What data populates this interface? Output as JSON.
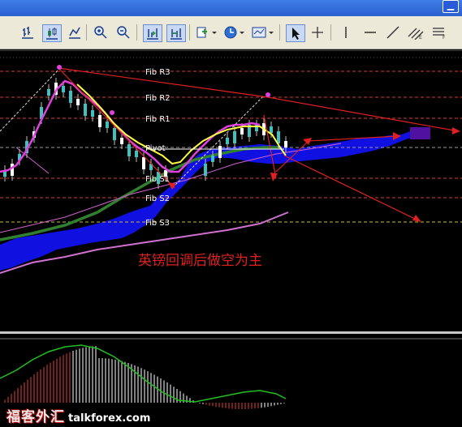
{
  "titlebar": {
    "minimize_icon": "minimize-icon"
  },
  "toolbar": {
    "buttons": [
      {
        "icon": "bar-chart-icon"
      },
      {
        "icon": "candlestick-icon"
      },
      {
        "icon": "line-chart-icon"
      },
      {
        "icon": "zoom-in-icon"
      },
      {
        "icon": "zoom-out-icon"
      },
      {
        "icon": "chart-shift-icon"
      },
      {
        "icon": "autoscroll-icon"
      },
      {
        "icon": "indicators-icon"
      },
      {
        "icon": "periods-clock-icon"
      },
      {
        "icon": "templates-icon"
      },
      {
        "icon": "cursor-icon"
      },
      {
        "icon": "crosshair-icon"
      },
      {
        "icon": "vertical-line-icon"
      },
      {
        "icon": "horizontal-line-icon"
      },
      {
        "icon": "trendline-icon"
      },
      {
        "icon": "equidistant-channel-icon"
      },
      {
        "icon": "fibonacci-icon"
      }
    ]
  },
  "chart_data": {
    "type": "candlestick",
    "fib_levels": [
      {
        "label": "Fib R3",
        "color": "#d04030"
      },
      {
        "label": "Fib R2",
        "color": "#d04030"
      },
      {
        "label": "Fib R1",
        "color": "#d04030"
      },
      {
        "label": "Pivot",
        "color": "#9a9a9a"
      },
      {
        "label": "Fib S1",
        "color": "#d04030"
      },
      {
        "label": "Fib S2",
        "color": "#d04030"
      },
      {
        "label": "Fib S3",
        "color": "#c8c030"
      }
    ],
    "annotation": "英镑回调后做空为主",
    "colors": {
      "background": "#000000",
      "cloud": "#1010e0",
      "bull_candle": "#40c0c0",
      "bear_candle": "#ffffff",
      "arrow": "#e02020",
      "ma_fast": "#e040e0",
      "ma_mid": "#ffff40",
      "ma_slow": "#308030",
      "ma_long": "#d070d0"
    },
    "macd_panel": {
      "line_color": "#20c020",
      "bar_color_up": "#e04040",
      "bar_color_down": "#ffffff"
    }
  },
  "watermark": {
    "chinese": "福客外汇",
    "url": "talkforex.com"
  }
}
